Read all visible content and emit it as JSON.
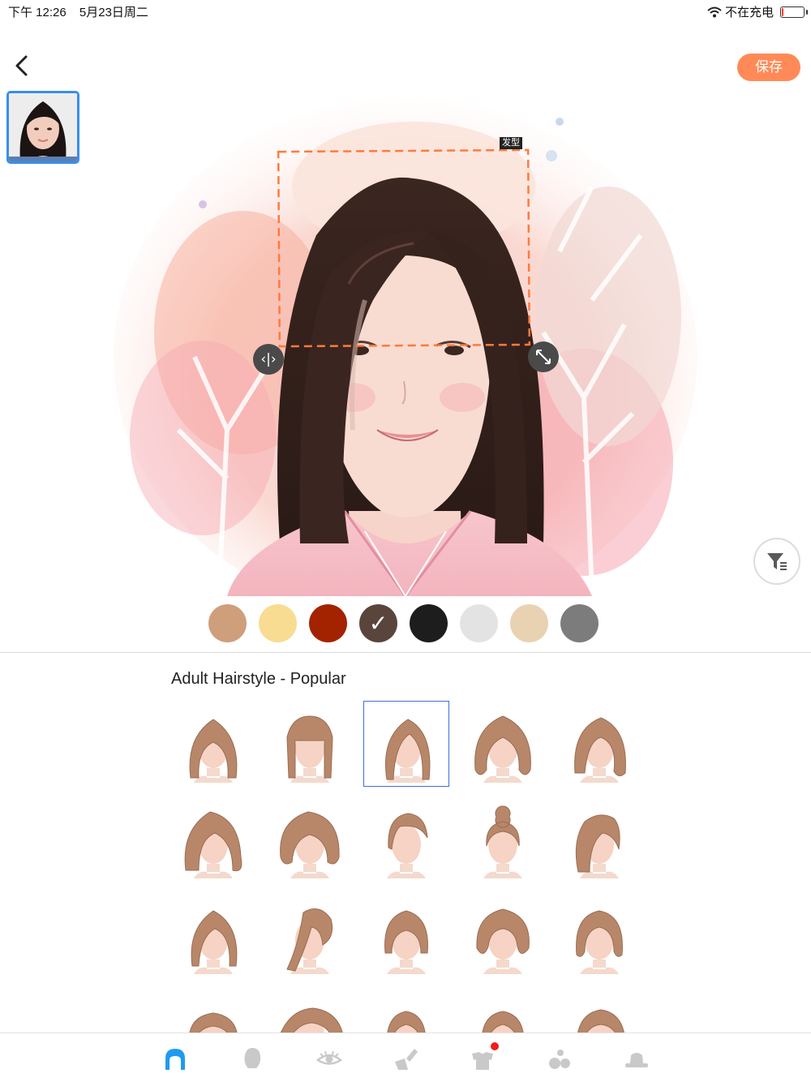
{
  "status": {
    "time": "下午 12:26",
    "date": "5月23日周二",
    "network": "不在充电",
    "battery_level": 0.08
  },
  "toolbar": {
    "save_label": "保存"
  },
  "editor": {
    "hair_tag": "发型"
  },
  "colors": {
    "swatches": [
      "#cf9e7b",
      "#f8dc92",
      "#a32300",
      "#5a453d",
      "#1d1d1d",
      "#e3e3e3",
      "#e8d2b2",
      "#7c7c7c"
    ],
    "selected_index": 3,
    "accent": "#ff8a57",
    "selection": "#3a8fe8",
    "tab_active": "#1e9bf0",
    "tab_inactive": "#c9c9c9"
  },
  "hairstyles": {
    "title": "Adult Hairstyle - Popular",
    "selected_index": 2,
    "rows": 4,
    "columns": 5
  },
  "tabs": [
    {
      "id": "hair",
      "icon": "hair-icon",
      "active": true
    },
    {
      "id": "face",
      "icon": "face-icon",
      "active": false
    },
    {
      "id": "eyes",
      "icon": "eye-icon",
      "active": false
    },
    {
      "id": "makeup",
      "icon": "makeup-brush-icon",
      "active": false
    },
    {
      "id": "clothes",
      "icon": "clothes-icon",
      "active": false,
      "badge": true
    },
    {
      "id": "accessories",
      "icon": "accessories-icon",
      "active": false
    },
    {
      "id": "hat",
      "icon": "hat-icon",
      "active": false
    }
  ]
}
